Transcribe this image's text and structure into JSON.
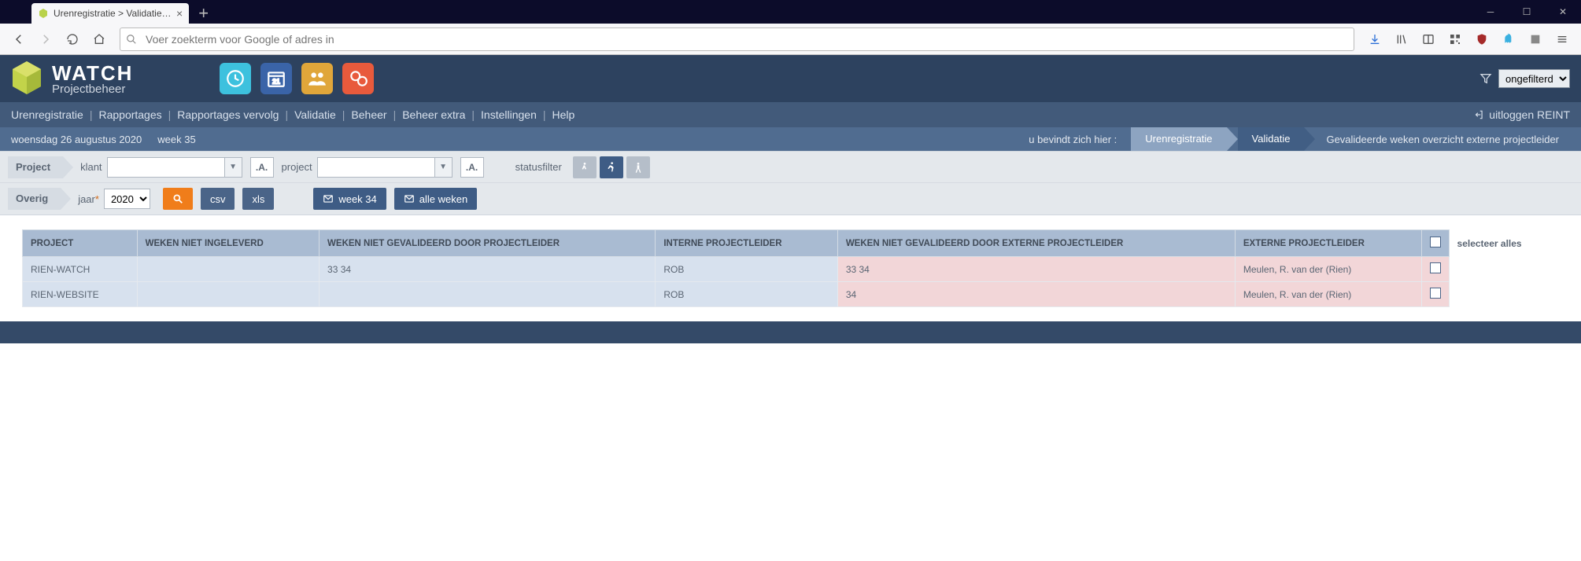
{
  "browser": {
    "tab_title": "Urenregistratie > Validatie > Ge",
    "address_placeholder": "Voer zoekterm voor Google of adres in"
  },
  "app": {
    "logo": {
      "line1": "WATCH",
      "line2": "Projectbeheer"
    },
    "header_icons": [
      "clock-icon",
      "calendar-icon",
      "people-icon",
      "chat-icon"
    ],
    "filter_value": "ongefilterd",
    "main_nav": [
      "Urenregistratie",
      "Rapportages",
      "Rapportages vervolg",
      "Validatie",
      "Beheer",
      "Beheer extra",
      "Instellingen",
      "Help"
    ],
    "logout_label": "uitloggen REINT",
    "context": {
      "date": "woensdag 26 augustus 2020",
      "week": "week 35",
      "bc_lead": "u bevindt zich hier :",
      "bc1": "Urenregistratie",
      "bc2": "Validatie",
      "bc3": "Gevalideerde weken overzicht externe projectleider"
    },
    "filters": {
      "row1_tag": "Project",
      "klant_label": "klant",
      "klant_btn": ".A.",
      "project_label": "project",
      "project_btn": ".A.",
      "statusfilter_label": "statusfilter",
      "row2_tag": "Overig",
      "jaar_label": "jaar",
      "jaar_value": "2020",
      "btn_csv": "csv",
      "btn_xls": "xls",
      "btn_week": "week 34",
      "btn_alle": "alle weken"
    },
    "table": {
      "headers": [
        "PROJECT",
        "WEKEN NIET INGELEVERD",
        "WEKEN NIET GEVALIDEERD DOOR PROJECTLEIDER",
        "INTERNE PROJECTLEIDER",
        "WEKEN NIET GEVALIDEERD DOOR EXTERNE PROJECTLEIDER",
        "EXTERNE PROJECTLEIDER"
      ],
      "select_all": "selecteer alles",
      "rows": [
        {
          "project": "RIEN-WATCH",
          "niet_ingeleverd": "",
          "niet_gevalideerd_pl": "33 34",
          "intern": "ROB",
          "niet_gevalideerd_ext": "33 34",
          "extern": "Meulen, R. van der (Rien)"
        },
        {
          "project": "RIEN-WEBSITE",
          "niet_ingeleverd": "",
          "niet_gevalideerd_pl": "",
          "intern": "ROB",
          "niet_gevalideerd_ext": "34",
          "extern": "Meulen, R. van der (Rien)"
        }
      ]
    }
  }
}
